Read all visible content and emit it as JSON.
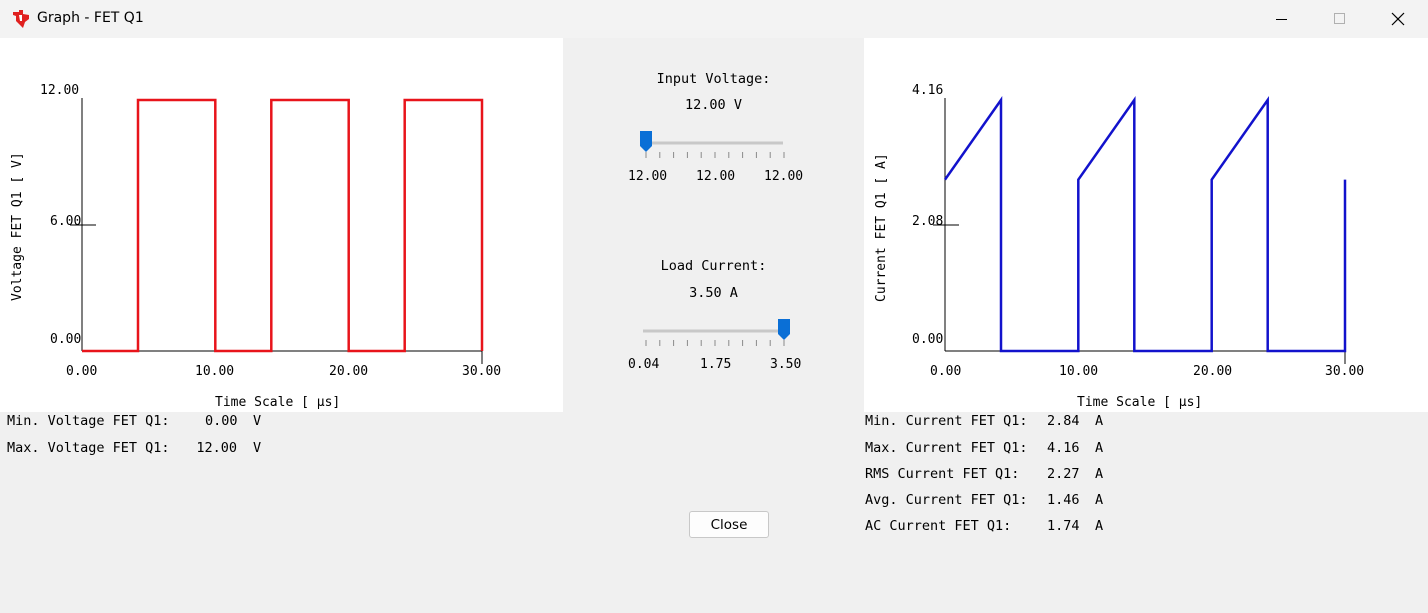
{
  "window": {
    "title": "Graph - FET Q1",
    "logo_icon": "ti-logo-icon",
    "logo_color": "#e0201f"
  },
  "voltage_chart": {
    "chart_data": {
      "type": "line",
      "ylabel": "Voltage FET Q1 [ V]",
      "xlabel": "Time Scale  [ μs]",
      "y_ticks": [
        "12.00",
        "6.00",
        "0.00"
      ],
      "x_ticks": [
        "0.00",
        "10.00",
        "20.00",
        "30.00"
      ],
      "xlim": [
        0,
        30
      ],
      "ylim": [
        0,
        12
      ],
      "color": "#e8141b",
      "series": [
        {
          "x": [
            0,
            4.2,
            4.2,
            10,
            10,
            14.2,
            14.2,
            20,
            20,
            24.2,
            24.2,
            30,
            30
          ],
          "y": [
            0,
            0,
            12,
            12,
            0,
            0,
            12,
            12,
            0,
            0,
            12,
            12,
            0
          ]
        }
      ]
    }
  },
  "current_chart": {
    "chart_data": {
      "type": "line",
      "ylabel": "Current FET Q1 [ A]",
      "xlabel": "Time Scale  [ μs]",
      "y_ticks": [
        "4.16",
        "2.08",
        "0.00"
      ],
      "x_ticks": [
        "0.00",
        "10.00",
        "20.00",
        "30.00"
      ],
      "xlim": [
        0,
        30
      ],
      "ylim": [
        0,
        4.16
      ],
      "color": "#1212cc",
      "series": [
        {
          "x": [
            0,
            4.2,
            4.2,
            10,
            10,
            14.2,
            14.2,
            20,
            20,
            24.2,
            24.2,
            30,
            30
          ],
          "y": [
            2.84,
            4.16,
            0,
            0,
            2.84,
            4.16,
            0,
            0,
            2.84,
            4.16,
            0,
            0,
            2.84
          ]
        }
      ]
    }
  },
  "input_voltage": {
    "label": "Input Voltage:",
    "value": "12.00 V",
    "ticks": [
      "12.00",
      "12.00",
      "12.00"
    ],
    "position_fraction": 0,
    "thumb_color": "#0a6fd6"
  },
  "load_current": {
    "label": "Load Current:",
    "value": "3.50  A",
    "ticks": [
      "0.04",
      "1.75",
      "3.50"
    ],
    "position_fraction": 1,
    "thumb_color": "#0a6fd6"
  },
  "voltage_stats": [
    {
      "label": "Min. Voltage FET Q1:",
      "value": "0.00",
      "unit": "V"
    },
    {
      "label": "Max. Voltage FET Q1:",
      "value": "12.00",
      "unit": "V"
    }
  ],
  "current_stats": [
    {
      "label": "Min. Current FET Q1:",
      "value": "2.84",
      "unit": "A"
    },
    {
      "label": "Max. Current FET Q1:",
      "value": "4.16",
      "unit": "A"
    },
    {
      "label": "RMS Current FET Q1:",
      "value": "2.27",
      "unit": "A"
    },
    {
      "label": "Avg. Current FET Q1:",
      "value": "1.46",
      "unit": "A"
    },
    {
      "label": "AC Current FET Q1:",
      "value": "1.74",
      "unit": "A"
    }
  ],
  "close_button": {
    "label": "Close"
  }
}
